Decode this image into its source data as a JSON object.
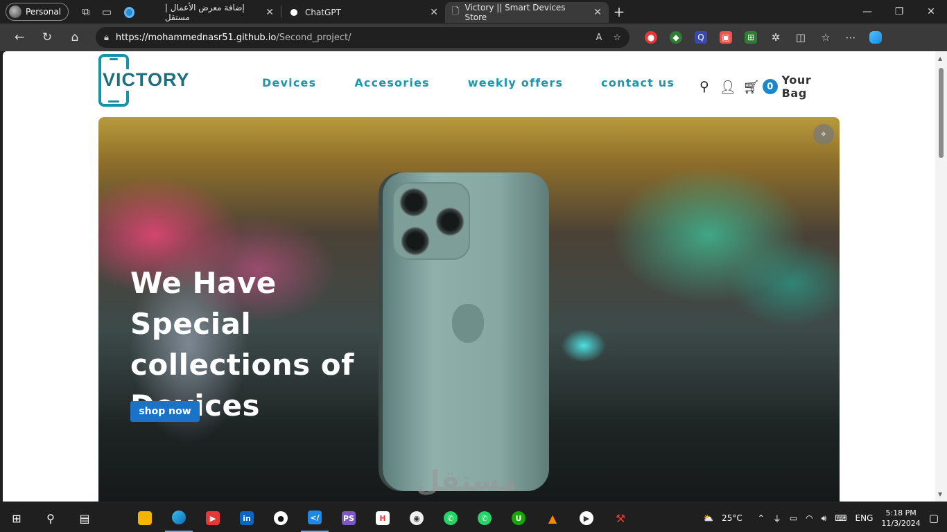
{
  "browser": {
    "profile_label": "Personal",
    "tabs": [
      {
        "title": "إضافة معرض الأعمال | مستقل",
        "active": false
      },
      {
        "title": "ChatGPT",
        "active": false
      },
      {
        "title": "Victory || Smart Devices Store",
        "active": true
      }
    ],
    "new_tab": "+",
    "url_host": "https://mohammednasr51.github.io",
    "url_path": "/Second_project/",
    "win_minimize": "—",
    "win_restore": "❐",
    "win_close": "✕"
  },
  "site": {
    "logo_text": "VICTORY",
    "nav": [
      "Devices",
      "Accesories",
      "weekly offers",
      "contact us"
    ],
    "bag_count": "0",
    "bag_label": "Your Bag"
  },
  "hero": {
    "title": "We Have Special collections of Devices",
    "button": "shop now"
  },
  "watermark": "مستقل",
  "taskbar": {
    "weather": "25°C",
    "lang": "ENG",
    "time": "5:18 PM",
    "date": "11/3/2024"
  },
  "colors": {
    "accent": "#1d97ad",
    "button": "#1a72c9",
    "bag_badge": "#1a88c9"
  }
}
